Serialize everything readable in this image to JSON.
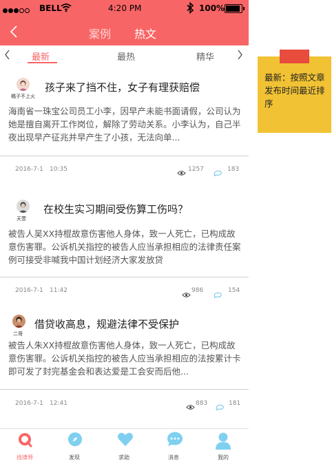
{
  "status_bar": {
    "carrier": "BELL",
    "time": "4:20 PM",
    "battery": "100%"
  },
  "nav": {
    "tab_cases": "案例",
    "tab_hot": "热文"
  },
  "sub_tabs": {
    "newest": "最新",
    "hottest": "最热",
    "featured": "精华"
  },
  "articles": [
    {
      "author": "橘子不上火",
      "title": "孩子来了挡不住，女子有理获赔偿",
      "body": "海南省一珠宝公司员工小李，因早产未能书面请假，公司认为她是擅自离开工作岗位，解除了劳动关系。小李认为，自己半夜出现早产征兆并早产生了小孩，无法向单...",
      "date": "2016-7-1",
      "time": "10:35",
      "views": "1257",
      "comments": "183"
    },
    {
      "author": "天萱",
      "title": "在校生实习期间受伤算工伤吗？",
      "body": "被告人吴XX持棍故意伤害他人身体，致一人死亡，已构成故意伤害罪。公诉机关指控的被告人应当承担相应的法律责任案例可接受非喊我中国计划经济大家发放贷",
      "date": "2016-7-1",
      "time": "11:42",
      "views": "986",
      "comments": "154"
    },
    {
      "author": "二哥",
      "title": "借贷收高息，规避法律不受保护",
      "body": "被告人朱XX持棍故意伤害他人身体，致一人死亡，已构成故意伤害罪。公诉机关指控的被告人应当承担相应的法按累计卡即可发了封完基金会和表达爱是工会安而后他...",
      "date": "2016-7-1",
      "time": "12:41",
      "views": "883",
      "comments": "181"
    }
  ],
  "bottom_nav": [
    {
      "label": "找律师",
      "icon": "search-icon"
    },
    {
      "label": "发现",
      "icon": "compass-icon"
    },
    {
      "label": "求助",
      "icon": "heart-icon"
    },
    {
      "label": "消息",
      "icon": "chat-icon"
    },
    {
      "label": "我的",
      "icon": "user-icon"
    }
  ],
  "annotation": {
    "text": "最新：按照文章发布时间最近排序"
  },
  "colors": {
    "brand": "#f86566",
    "note": "#f1c234",
    "note_tab": "#e84c3d"
  }
}
